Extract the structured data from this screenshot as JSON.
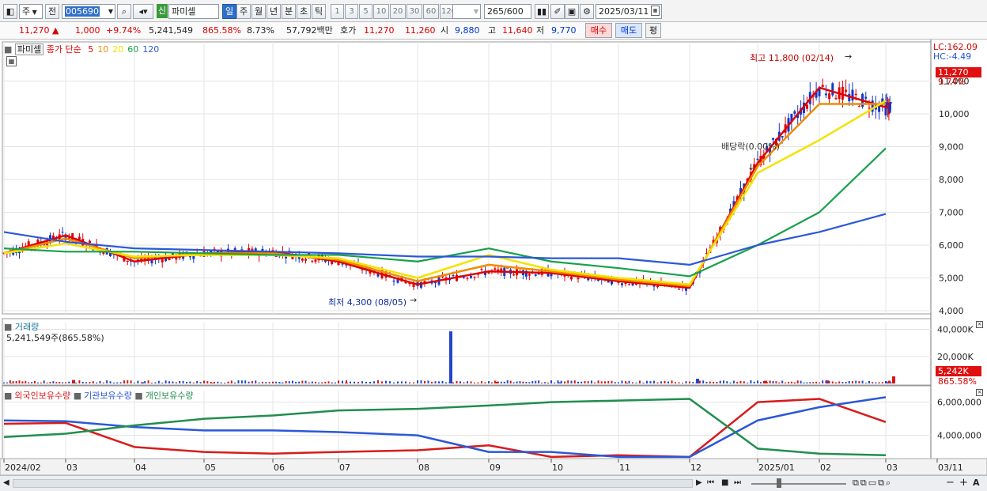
{
  "toolbar": {
    "market": "주",
    "prev_label": "전",
    "code": "005690",
    "sign": "신",
    "name": "파미셀",
    "periods": [
      "일",
      "주",
      "월",
      "년",
      "분",
      "초",
      "틱"
    ],
    "active_period": "일",
    "nums": [
      "1",
      "3",
      "5",
      "10",
      "20",
      "30",
      "60",
      "120"
    ],
    "count": "265",
    "count_total": "/600",
    "date": "2025/03/11"
  },
  "quote": {
    "price": "11,270",
    "change": "1,000",
    "change_pct": "+9.74%",
    "volume": "5,241,549",
    "vol_ratio": "865.58%",
    "turnover": "8.73%",
    "amount": "57,792백만",
    "hoga_label": "호가",
    "ask": "11,270",
    "bid": "11,260",
    "open_label": "시",
    "open": "9,880",
    "high_label": "고",
    "high": "11,640",
    "low_label": "저",
    "low": "9,770",
    "buy_label": "매수",
    "sell_label": "매도",
    "eval_label": "평"
  },
  "price_panel": {
    "stock_tag": "파미셀",
    "legend_title": "종가 단순",
    "ma_labels": [
      {
        "text": "5",
        "color": "#e00000"
      },
      {
        "text": "10",
        "color": "#f08c00"
      },
      {
        "text": "20",
        "color": "#f4e200"
      },
      {
        "text": "60",
        "color": "#18a04a"
      },
      {
        "text": "120",
        "color": "#2b58d8"
      }
    ],
    "lc": "LC:162.09",
    "hc": "HC:-4.49",
    "last_price_tag": "11,270",
    "last_pct": "9.74%",
    "y_ticks": [
      "11,000",
      "10,000",
      "9,000",
      "8,000",
      "7,000",
      "6,000",
      "5,000",
      "4,000"
    ],
    "high_annotation": "최고 11,800 (02/14)",
    "low_annotation": "최저 4,300 (08/05)",
    "dividend_annotation": "배당락(0.00%)"
  },
  "volume_panel": {
    "title": "거래량",
    "value": "5,241,549주(865.58%)",
    "y_ticks": [
      "40,000K",
      "20,000K"
    ],
    "last_tag": "5,242K",
    "last_pct": "865.58%"
  },
  "holding_panel": {
    "legend": [
      {
        "text": "외국인보유수량",
        "color": "#d81b1b"
      },
      {
        "text": "기관보유수량",
        "color": "#2b58d8"
      },
      {
        "text": "개인보유수량",
        "color": "#208e4e"
      }
    ],
    "y_ticks": [
      "6,000,000",
      "4,000,000"
    ]
  },
  "x_axis": [
    "2024/02",
    "03",
    "04",
    "05",
    "06",
    "07",
    "08",
    "09",
    "10",
    "11",
    "12",
    "2025/01",
    "02",
    "03",
    "03/11"
  ],
  "chart_data": [
    {
      "type": "line",
      "title": "",
      "x": [
        "2024/02",
        "03",
        "04",
        "05",
        "06",
        "07",
        "08",
        "09",
        "10",
        "11",
        "12",
        "2025/01",
        "02",
        "03"
      ],
      "ylim": [
        4000,
        12000
      ],
      "series": [
        {
          "name": "5",
          "values": [
            5750,
            6300,
            5500,
            5750,
            5800,
            5500,
            4800,
            5200,
            5150,
            4900,
            4700,
            8500,
            10800,
            10200
          ]
        },
        {
          "name": "10",
          "values": [
            5750,
            6200,
            5600,
            5750,
            5750,
            5550,
            4900,
            5400,
            5200,
            4950,
            4750,
            8400,
            10300,
            10300
          ]
        },
        {
          "name": "20",
          "values": [
            5750,
            6050,
            5650,
            5700,
            5700,
            5600,
            5000,
            5700,
            5250,
            5000,
            4800,
            8200,
            9200,
            10400
          ]
        },
        {
          "name": "60",
          "values": [
            5900,
            5800,
            5800,
            5750,
            5700,
            5700,
            5500,
            5900,
            5500,
            5300,
            5050,
            6000,
            7000,
            8950
          ]
        },
        {
          "name": "120",
          "values": [
            6400,
            6100,
            5900,
            5850,
            5800,
            5750,
            5650,
            5650,
            5600,
            5600,
            5400,
            6000,
            6400,
            6950
          ]
        }
      ],
      "annotations": [
        "최고 11,800 (02/14)",
        "최저 4,300 (08/05)",
        "배당락(0.00%)"
      ]
    },
    {
      "type": "bar",
      "title": "거래량",
      "categories": [
        "2024/02",
        "03",
        "04",
        "05",
        "06",
        "07",
        "08",
        "09",
        "10",
        "11",
        "12",
        "2025/01",
        "02",
        "03"
      ],
      "values": [
        400,
        2600,
        900,
        500,
        300,
        600,
        38500,
        1200,
        800,
        600,
        3500,
        2000,
        2200,
        5242
      ],
      "ylim": [
        0,
        45000
      ]
    },
    {
      "type": "line",
      "title": "",
      "x": [
        "2024/02",
        "03",
        "04",
        "05",
        "06",
        "07",
        "08",
        "09",
        "10",
        "11",
        "12",
        "2025/01",
        "02",
        "03"
      ],
      "ylim": [
        2600000,
        6700000
      ],
      "series": [
        {
          "name": "외국인보유수량",
          "values": [
            4700000,
            4750000,
            3300000,
            3000000,
            2900000,
            3000000,
            3100000,
            3400000,
            2700000,
            2800000,
            2700000,
            6000000,
            6200000,
            4800000
          ]
        },
        {
          "name": "기관보유수량",
          "values": [
            4900000,
            4850000,
            4500000,
            4300000,
            4300000,
            4200000,
            4000000,
            3000000,
            3000000,
            2700000,
            2700000,
            4900000,
            5700000,
            6300000
          ]
        },
        {
          "name": "개인보유수량",
          "values": [
            3900000,
            4100000,
            4600000,
            5000000,
            5200000,
            5500000,
            5600000,
            5800000,
            6000000,
            6100000,
            6200000,
            3200000,
            2900000,
            2800000
          ]
        }
      ]
    }
  ]
}
